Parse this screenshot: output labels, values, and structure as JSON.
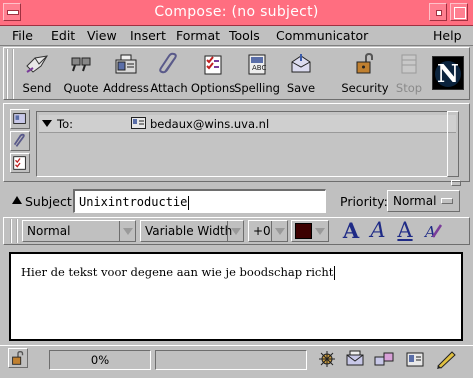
{
  "window": {
    "title": "Compose: (no subject)"
  },
  "menu": [
    "File",
    "Edit",
    "View",
    "Insert",
    "Format",
    "Tools",
    "Communicator",
    "Help"
  ],
  "toolbar": {
    "send": "Send",
    "quote": "Quote",
    "address": "Address",
    "attach": "Attach",
    "options": "Options",
    "spelling": "Spelling",
    "save": "Save",
    "security": "Security",
    "stop": "Stop",
    "logo_letter": "N"
  },
  "recipients": [
    {
      "type": "To:",
      "address": "bedaux@wins.uva.nl"
    }
  ],
  "subject": {
    "label": "Subject:",
    "value": "Unixintroductie"
  },
  "priority": {
    "label": "Priority:",
    "value": "Normal"
  },
  "format": {
    "paragraph_style": "Normal",
    "font": "Variable Width",
    "size": "+0",
    "text_color": "#3c0000",
    "letters": [
      "A",
      "A",
      "A"
    ]
  },
  "body": {
    "text": "Hier de tekst voor degene aan wie je boodschap richt"
  },
  "status": {
    "progress": "0%"
  },
  "colors": {
    "titlebar": "#ff6e80",
    "chrome": "#c0c0c0",
    "format_icon": "#1f2b86"
  }
}
